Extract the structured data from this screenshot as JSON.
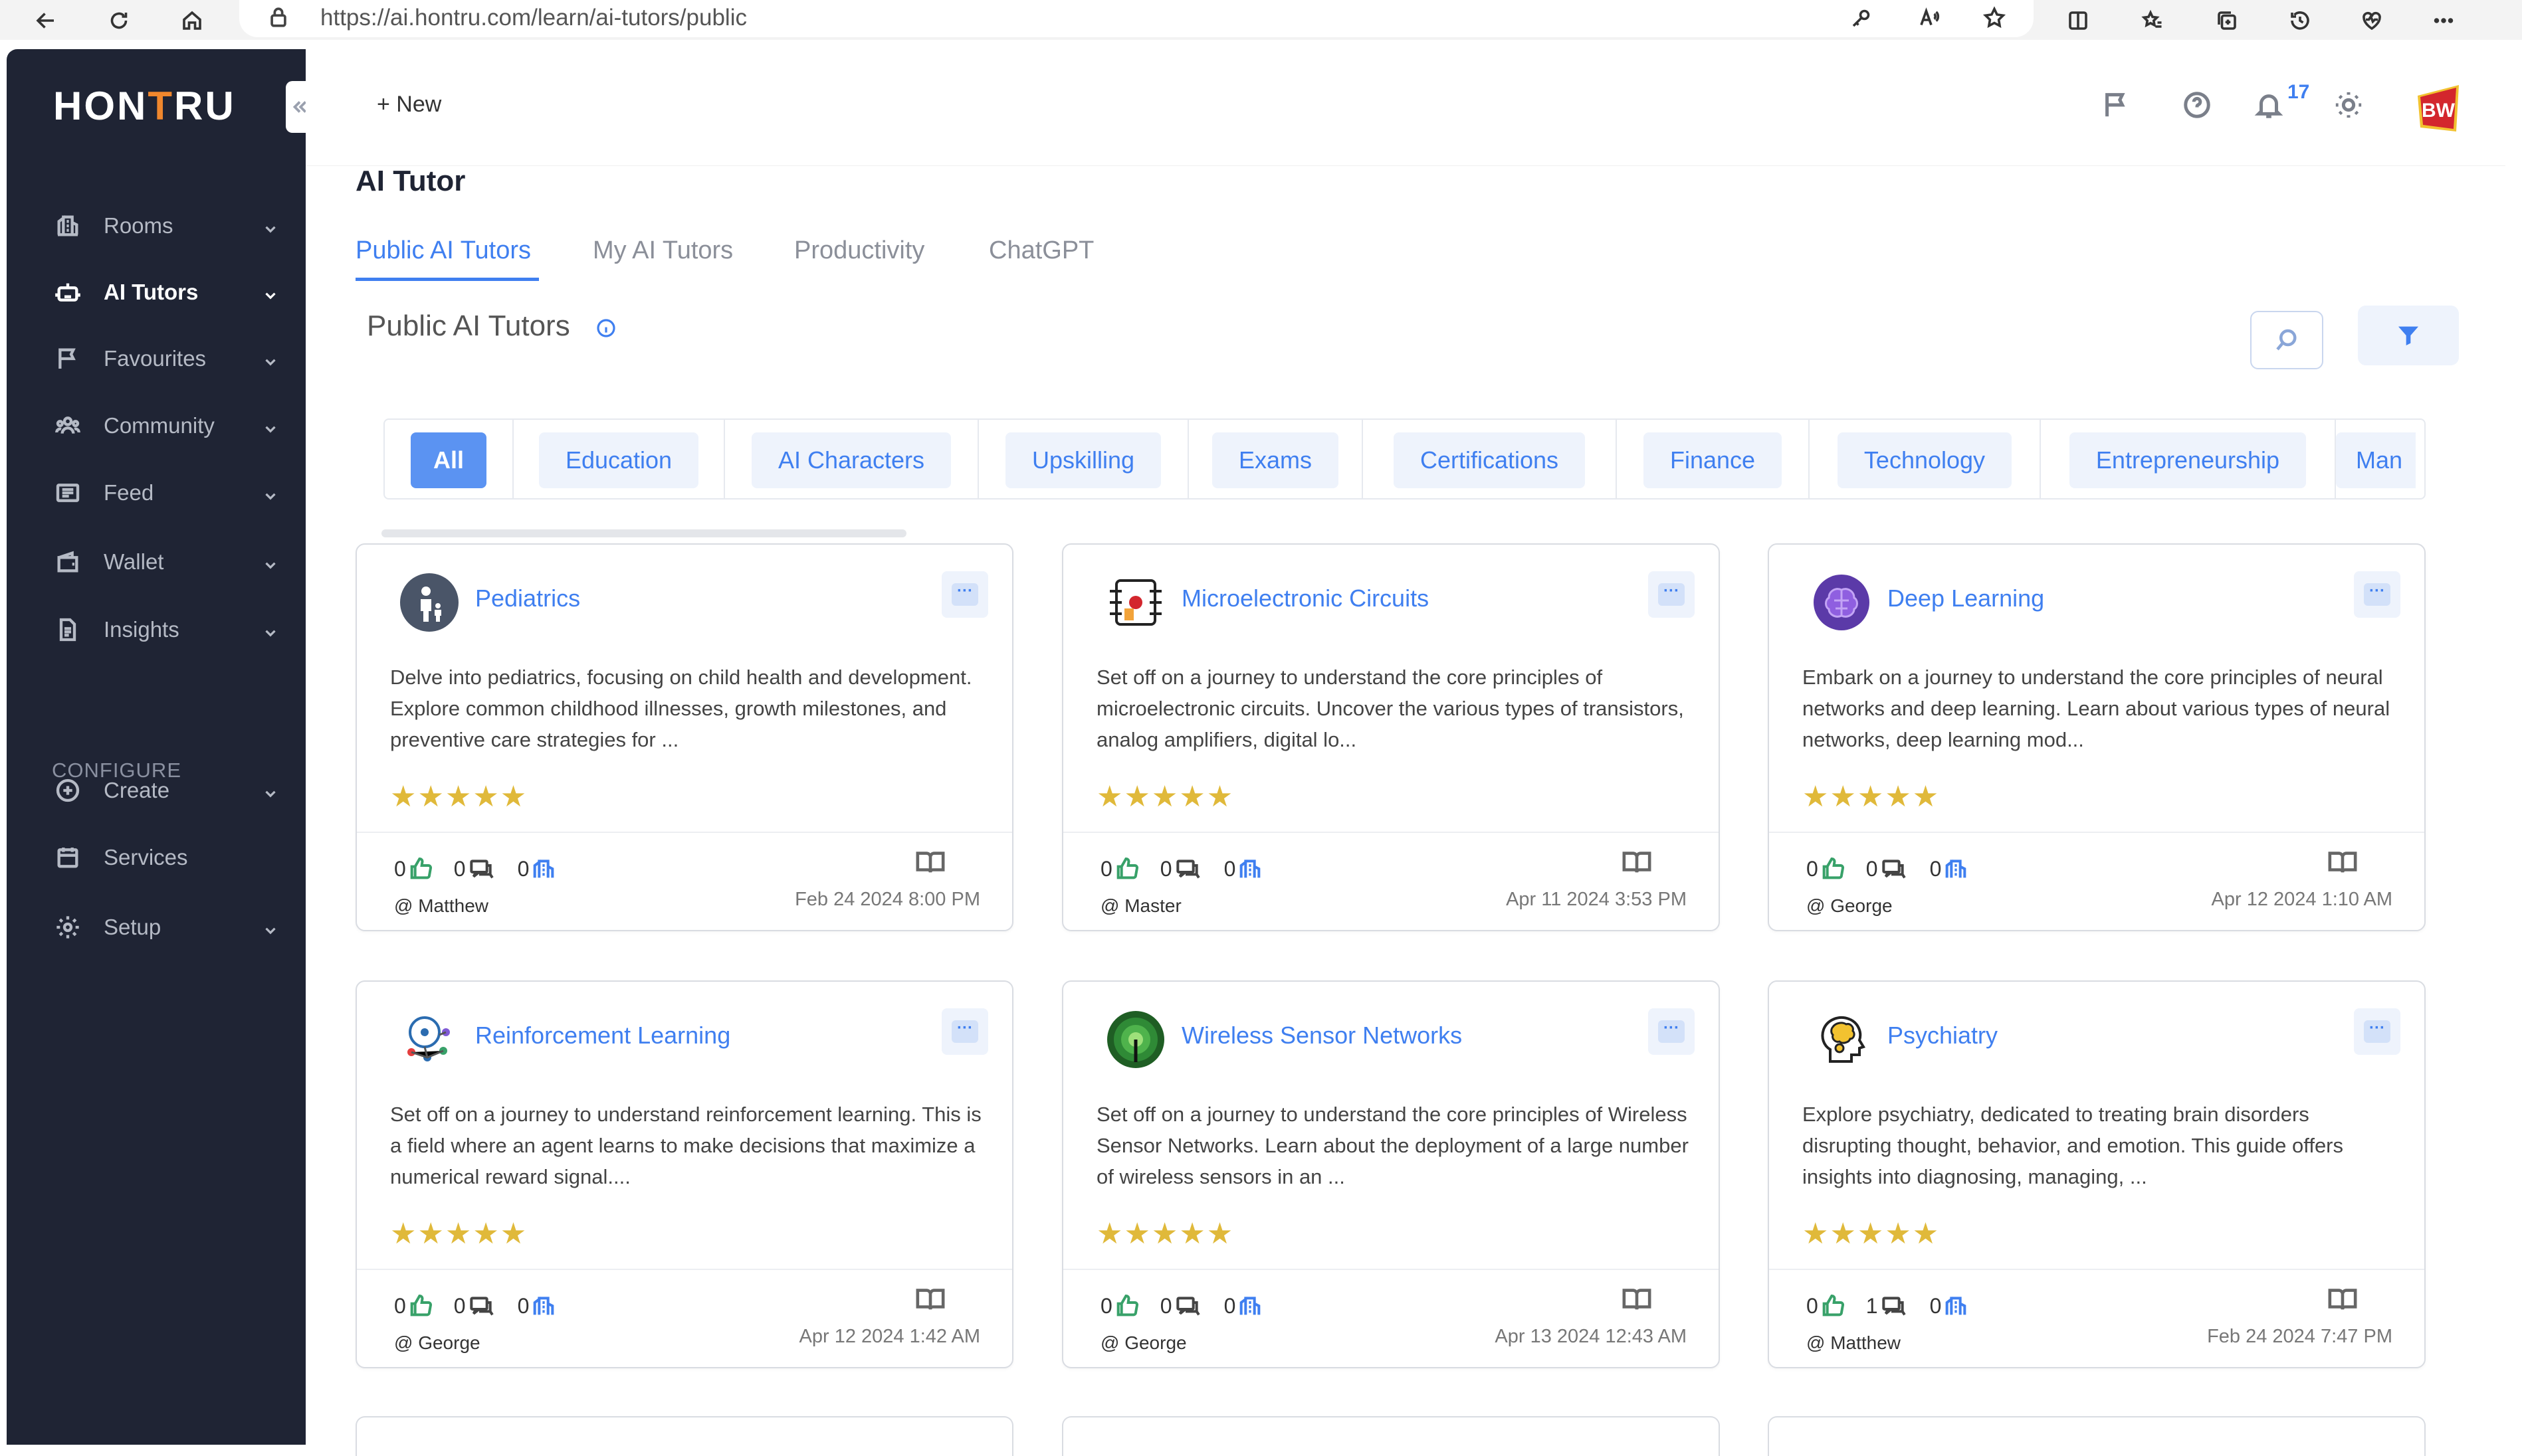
{
  "browser": {
    "url": "https://ai.hontru.com/learn/ai-tutors/public"
  },
  "brand": {
    "logo_pre": "HON",
    "logo_t": "T",
    "logo_post": "RU",
    "accent": "#3f7ff0",
    "sidebar_bg": "#1f2434",
    "logo_accent": "#f0872d"
  },
  "sidebar": {
    "items": [
      {
        "label": "Rooms",
        "icon": "building-icon"
      },
      {
        "label": "AI Tutors",
        "icon": "robot-icon",
        "active": true
      },
      {
        "label": "Favourites",
        "icon": "flag-icon"
      },
      {
        "label": "Community",
        "icon": "people-icon"
      },
      {
        "label": "Feed",
        "icon": "feed-icon"
      },
      {
        "label": "Wallet",
        "icon": "wallet-icon"
      },
      {
        "label": "Insights",
        "icon": "document-icon"
      }
    ],
    "configure_label": "CONFIGURE",
    "config_items": [
      {
        "label": "Create",
        "icon": "plus-circle-icon"
      },
      {
        "label": "Services",
        "icon": "calendar-icon"
      },
      {
        "label": "Setup",
        "icon": "gear-icon"
      }
    ]
  },
  "topbar": {
    "new_label": "+ New",
    "notification_count": "17",
    "avatar_text": "BW"
  },
  "page": {
    "title": "AI Tutor",
    "tabs": [
      "Public AI Tutors",
      "My AI Tutors",
      "Productivity",
      "ChatGPT"
    ],
    "section_title": "Public AI Tutors"
  },
  "categories": [
    "All",
    "Education",
    "AI Characters",
    "Upskilling",
    "Exams",
    "Certifications",
    "Finance",
    "Technology",
    "Entrepreneurship",
    "Man"
  ],
  "cards": [
    {
      "title": "Pediatrics",
      "desc": "Delve into pediatrics, focusing on child health and development. Explore common childhood illnesses, growth milestones, and preventive care strategies for ...",
      "stars": "★★★★★",
      "likes": "0",
      "comments": "0",
      "views": "0",
      "author": "@ Matthew",
      "date": "Feb 24 2024 8:00 PM",
      "icon": "pediatrics-icon"
    },
    {
      "title": "Microelectronic Circuits",
      "desc": "Set off on a journey to understand the core principles of microelectronic circuits. Uncover the various types of transistors, analog amplifiers, digital lo...",
      "stars": "★★★★★",
      "likes": "0",
      "comments": "0",
      "views": "0",
      "author": "@ Master",
      "date": "Apr 11 2024 3:53 PM",
      "icon": "circuit-icon"
    },
    {
      "title": "Deep Learning",
      "desc": "Embark on a journey to understand the core principles of neural networks and deep learning. Learn about various types of neural networks, deep learning mod...",
      "stars": "★★★★★",
      "likes": "0",
      "comments": "0",
      "views": "0",
      "author": "@ George",
      "date": "Apr 12 2024 1:10 AM",
      "icon": "brain-icon"
    },
    {
      "title": "Reinforcement Learning",
      "desc": "Set off on a journey to understand reinforcement learning. This is a field where an agent learns to make decisions that maximize a numerical reward signal....",
      "stars": "★★★★★",
      "likes": "0",
      "comments": "0",
      "views": "0",
      "author": "@ George",
      "date": "Apr 12 2024 1:42 AM",
      "icon": "network-head-icon"
    },
    {
      "title": "Wireless Sensor Networks",
      "desc": "Set off on a journey to understand the core principles of Wireless Sensor Networks. Learn about the deployment of a large number of wireless sensors in an ...",
      "stars": "★★★★★",
      "likes": "0",
      "comments": "0",
      "views": "0",
      "author": "@ George",
      "date": "Apr 13 2024 12:43 AM",
      "icon": "wireless-icon"
    },
    {
      "title": "Psychiatry",
      "desc": "Explore psychiatry, dedicated to treating brain disorders disrupting thought, behavior, and emotion. This guide offers insights into diagnosing, managing, ...",
      "stars": "★★★★★",
      "likes": "0",
      "comments": "1",
      "views": "0",
      "author": "@ Matthew",
      "date": "Feb 24 2024 7:47 PM",
      "icon": "head-brain-icon"
    }
  ]
}
